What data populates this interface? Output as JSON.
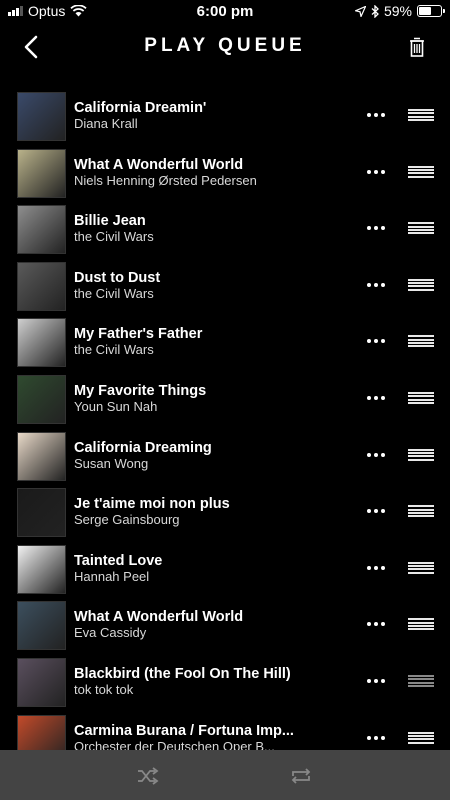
{
  "status_bar": {
    "carrier": "Optus",
    "time": "6:00 pm",
    "battery_percent": "59%",
    "battery_level": 0.59,
    "icons": [
      "signal-icon",
      "wifi-icon",
      "location-arrow-icon",
      "bluetooth-icon",
      "battery-icon"
    ]
  },
  "header": {
    "title": "PLAY QUEUE",
    "back_icon": "chevron-left-icon",
    "trash_icon": "trash-icon"
  },
  "queue": [
    {
      "title": "California Dreamin'",
      "artist": "Diana Krall",
      "art_color": "#3a4a6a"
    },
    {
      "title": "What A Wonderful World",
      "artist": "Niels Henning Ørsted Pedersen",
      "art_color": "#b9b28a"
    },
    {
      "title": "Billie Jean",
      "artist": "the Civil Wars",
      "art_color": "#8e8e8e"
    },
    {
      "title": "Dust to Dust",
      "artist": "the Civil Wars",
      "art_color": "#5a5a5a"
    },
    {
      "title": "My Father's Father",
      "artist": "the Civil Wars",
      "art_color": "#cfcfcf"
    },
    {
      "title": "My Favorite Things",
      "artist": "Youn Sun Nah",
      "art_color": "#2f4a2f"
    },
    {
      "title": "California Dreaming",
      "artist": "Susan Wong",
      "art_color": "#e8d9c8"
    },
    {
      "title": "Je t'aime moi non plus",
      "artist": "Serge Gainsbourg",
      "art_color": "#1a1a1a"
    },
    {
      "title": "Tainted Love",
      "artist": "Hannah Peel",
      "art_color": "#f2f2f2"
    },
    {
      "title": "What A Wonderful World",
      "artist": "Eva Cassidy",
      "art_color": "#3c4f5e"
    },
    {
      "title": "Blackbird (the Fool On The Hill)",
      "artist": "tok tok tok",
      "art_color": "#5a4f5e"
    },
    {
      "title": "Carmina Burana / Fortuna Imp...",
      "artist": "Orchester der Deutschen Oper B...",
      "art_color": "#c24a2a"
    }
  ],
  "row_icons": {
    "more": "more-dots-icon",
    "drag": "drag-handle-icon"
  },
  "bottom_bar": {
    "shuffle_icon": "shuffle-icon",
    "repeat_icon": "repeat-icon"
  }
}
